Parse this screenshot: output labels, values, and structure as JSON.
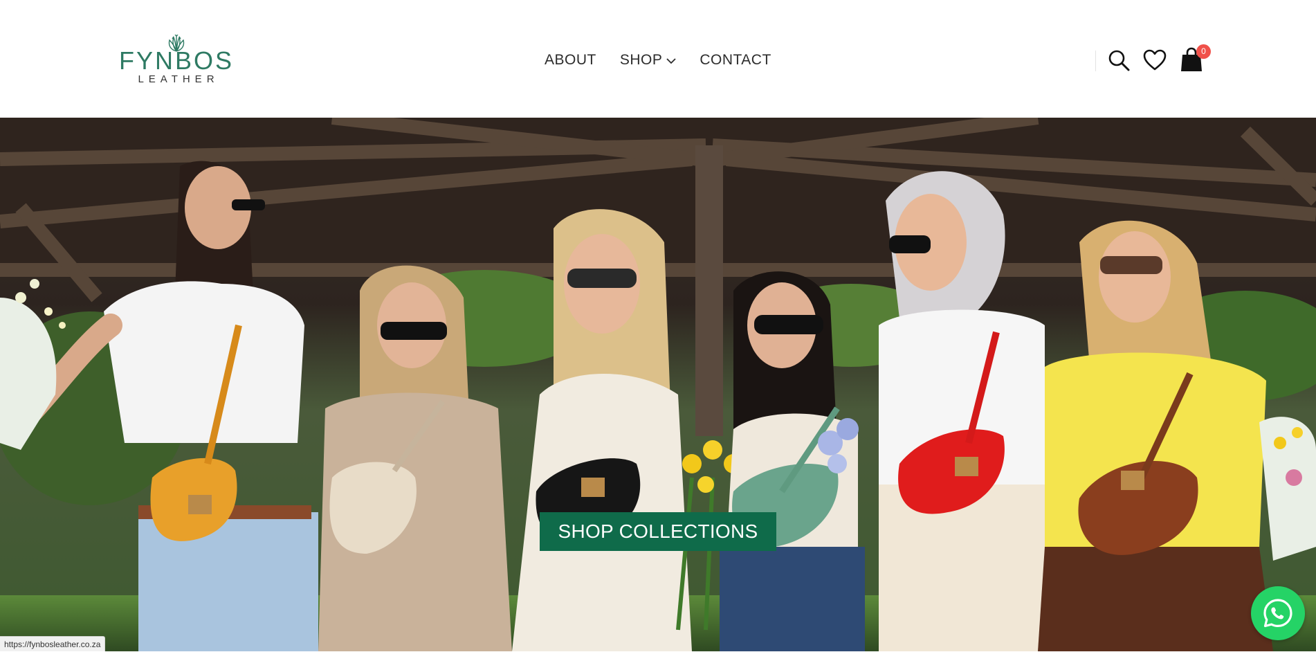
{
  "brand": {
    "name": "FYNBOS",
    "sub": "LEATHER",
    "color": "#2e7a63"
  },
  "nav": {
    "about": "ABOUT",
    "shop": "SHOP",
    "contact": "CONTACT"
  },
  "tools": {
    "cart_count": "0",
    "badge_color": "#f0514a"
  },
  "hero": {
    "cta_label": "SHOP COLLECTIONS",
    "cta_color": "#0f6b4a"
  },
  "status_bar": {
    "url": "https://fynbosleather.co.za"
  },
  "whatsapp": {
    "color": "#25d366"
  }
}
